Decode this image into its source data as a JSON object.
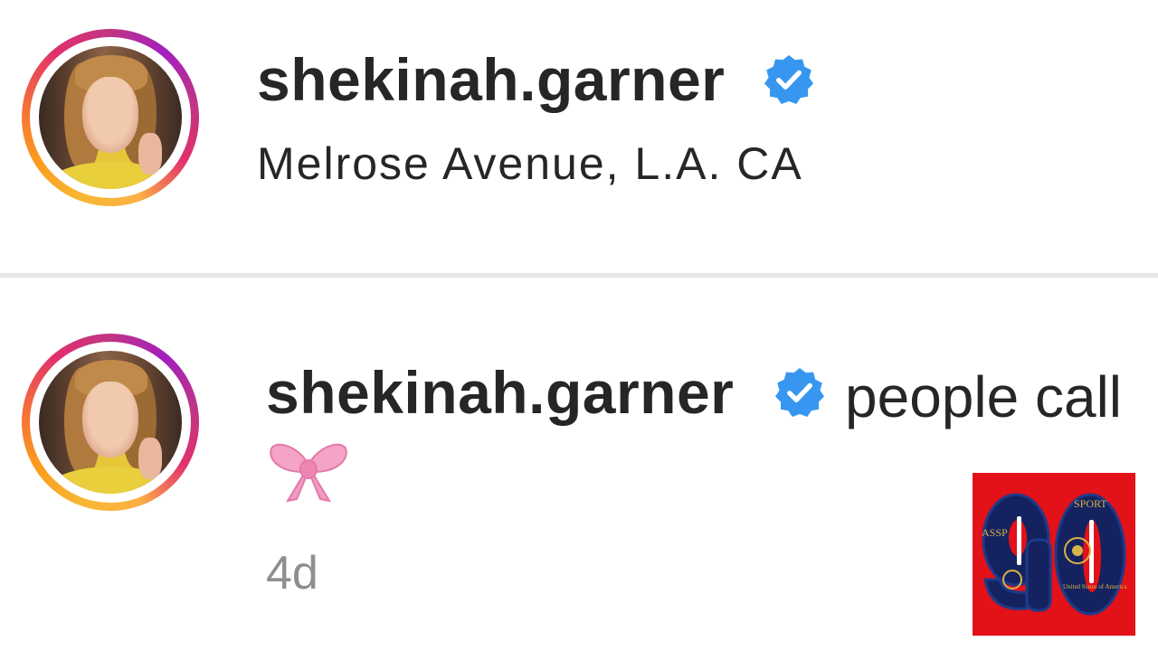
{
  "header": {
    "username": "shekinah.garner",
    "verified_icon": "verified-badge-icon",
    "location": "Melrose Avenue, L.A. CA"
  },
  "comment": {
    "username": "shekinah.garner",
    "verified_icon": "verified-badge-icon",
    "text": "people call",
    "emoji_icon": "pink-ribbon-bow-icon",
    "timestamp": "4d"
  },
  "watermark": {
    "number": "90",
    "passport_text_left": "ASSP",
    "passport_text_right": "SPORT",
    "passport_sub": "United States of America"
  },
  "colors": {
    "verified_blue": "#3797f0",
    "timestamp_gray": "#8e8e8e",
    "logo_red": "#e31118",
    "logo_navy": "#14235f",
    "ribbon_pink": "#f5a3c7"
  }
}
